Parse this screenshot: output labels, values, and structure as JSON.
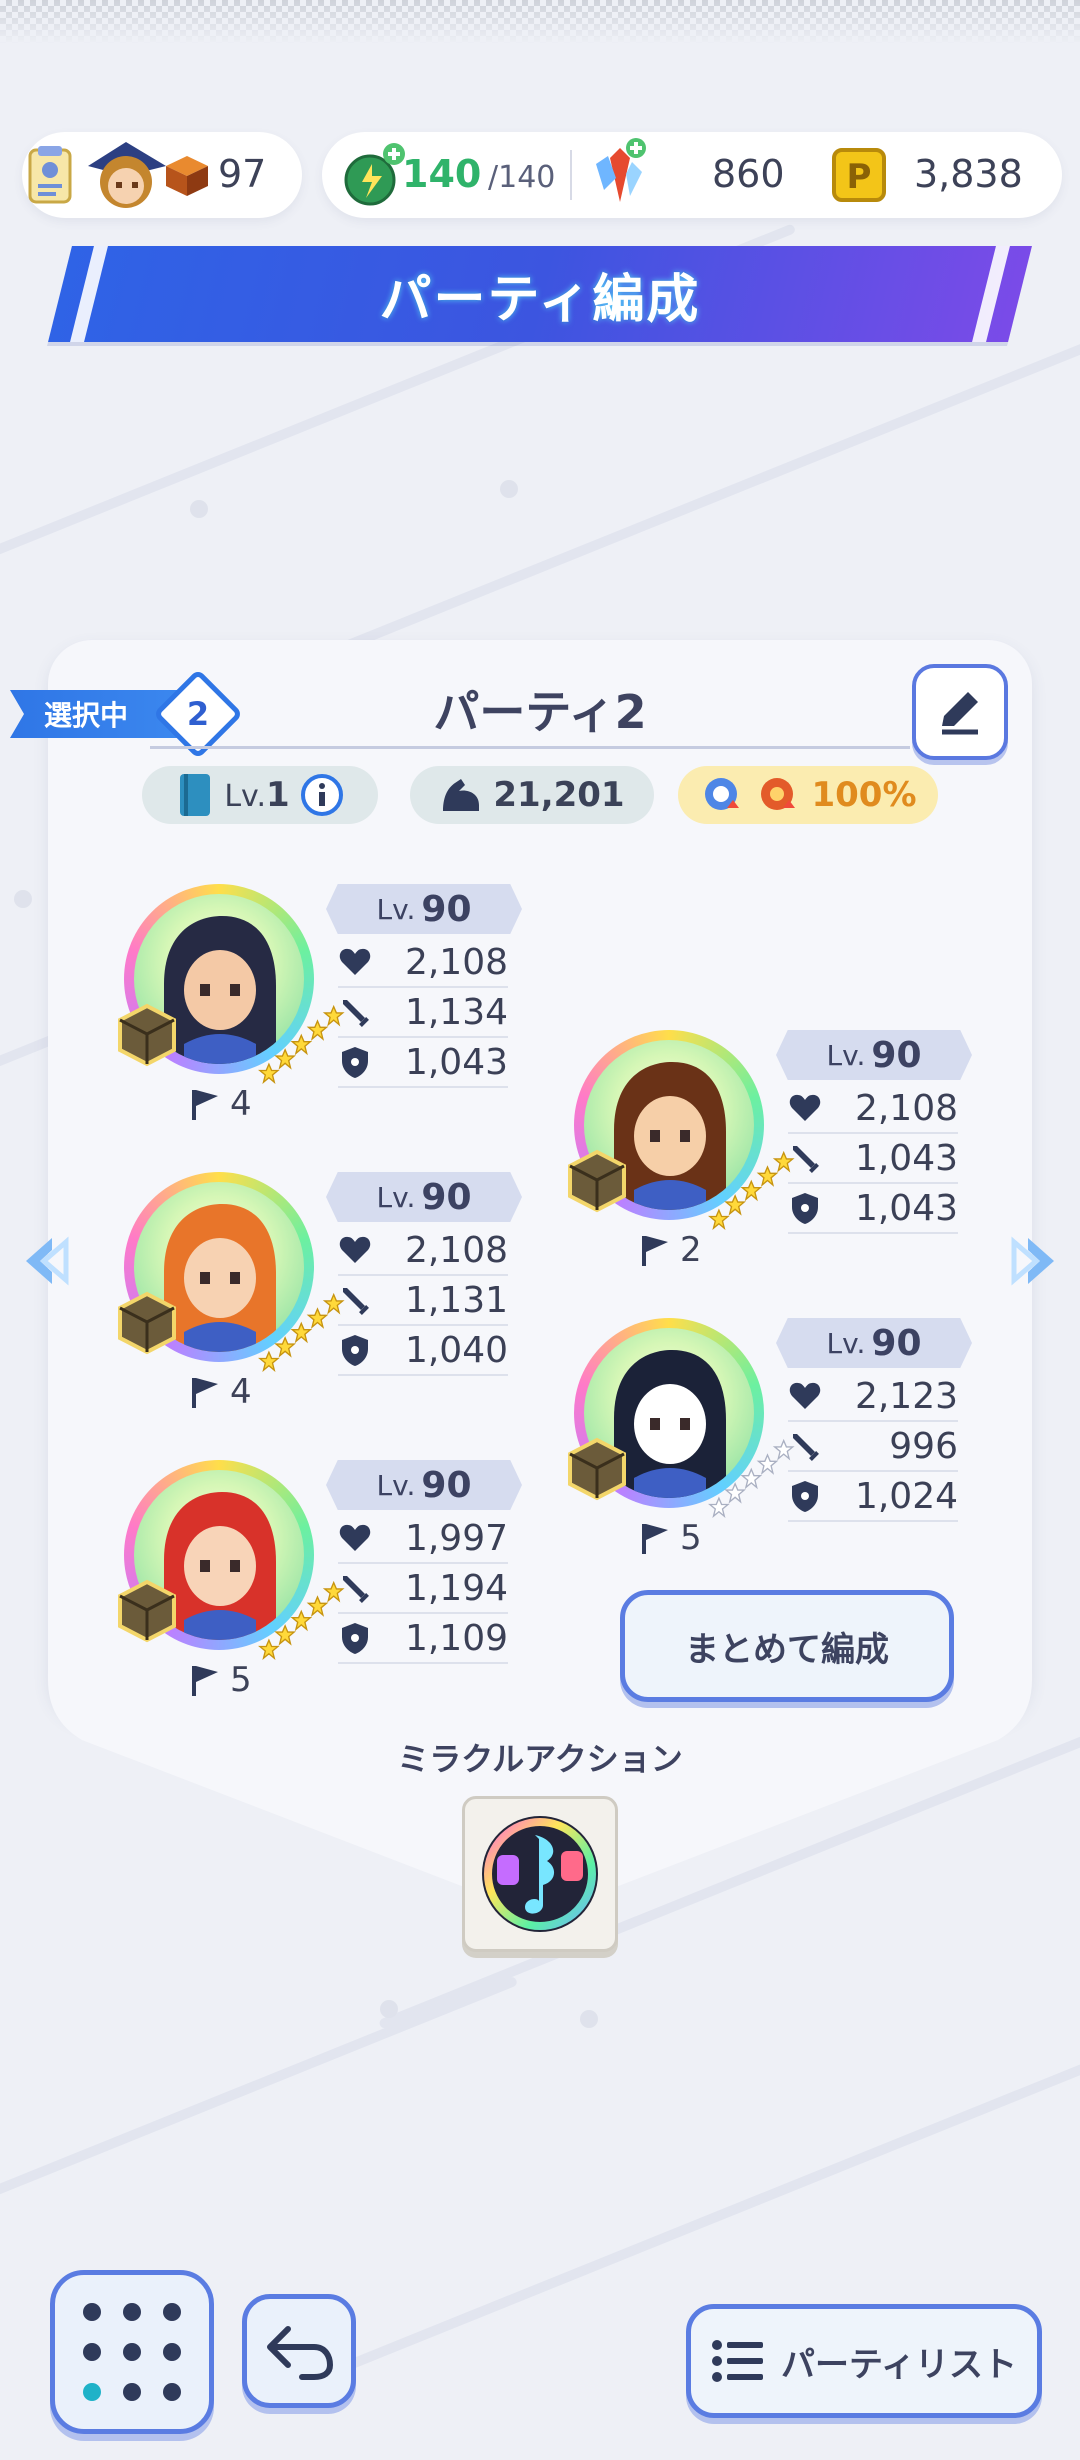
{
  "header": {
    "title": "パーティ編成",
    "rank_items": "97",
    "stamina": "140",
    "stamina_max": "/140",
    "gems": "860",
    "coins": "3,838"
  },
  "party": {
    "selected_label": "選択中",
    "selected_number": "2",
    "name": "パーティ2",
    "book_level_prefix": "Lv.",
    "book_level": "1",
    "total_power": "21,201",
    "bonus_percent": "100%"
  },
  "characters": [
    {
      "lv_label": "Lv.",
      "level": "90",
      "hp": "2,108",
      "atk": "1,134",
      "def": "1,043",
      "flag": "4",
      "stars": 5,
      "hair": "#262a44",
      "skin": "#f4c9a6"
    },
    {
      "lv_label": "Lv.",
      "level": "90",
      "hp": "2,108",
      "atk": "1,043",
      "def": "1,043",
      "flag": "2",
      "stars": 5,
      "hair": "#6a3217",
      "skin": "#f6cfa8"
    },
    {
      "lv_label": "Lv.",
      "level": "90",
      "hp": "2,108",
      "atk": "1,131",
      "def": "1,040",
      "flag": "4",
      "stars": 5,
      "hair": "#e8752a",
      "skin": "#f7d2b2"
    },
    {
      "lv_label": "Lv.",
      "level": "90",
      "hp": "2,123",
      "atk": "996",
      "def": "1,024",
      "flag": "5",
      "stars": 0,
      "hair": "#1b2238",
      "skin": "#ffffff"
    },
    {
      "lv_label": "Lv.",
      "level": "90",
      "hp": "1,997",
      "atk": "1,194",
      "def": "1,109",
      "flag": "5",
      "stars": 5,
      "hair": "#d8322a",
      "skin": "#f8d4b8"
    }
  ],
  "buttons": {
    "bulk_edit": "まとめて編成",
    "party_list": "パーティリスト"
  },
  "miracle": {
    "label": "ミラクルアクション"
  },
  "colors": {
    "accent_blue": "#3c55e0",
    "button_border": "#5a7ce2",
    "bonus_text": "#e08b1e"
  }
}
